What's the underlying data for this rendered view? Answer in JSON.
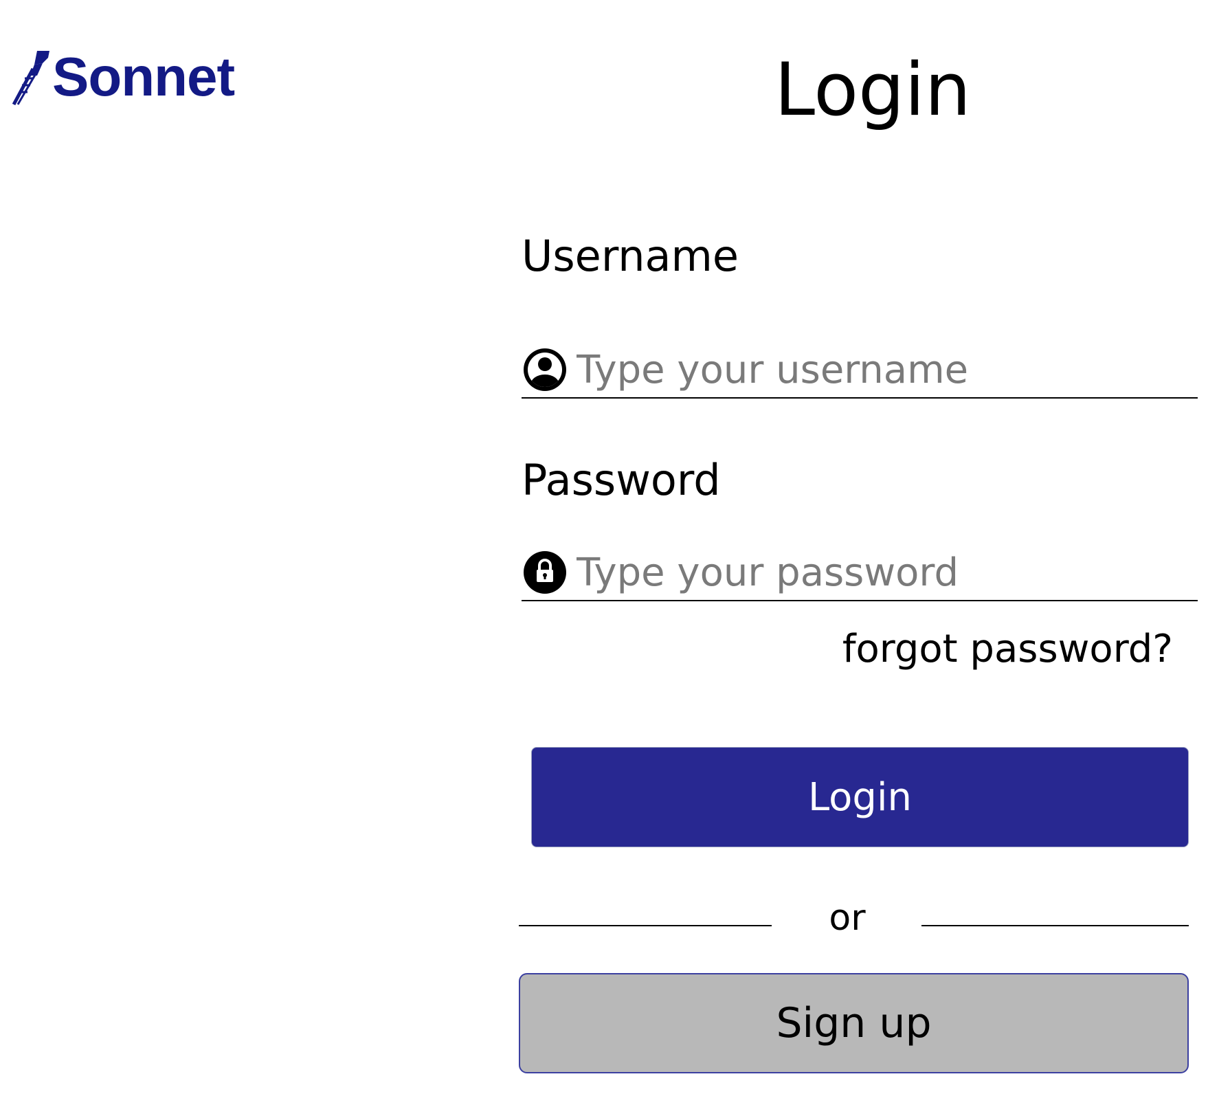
{
  "brand": {
    "name": "Sonnet",
    "logo_icon": "quill-pen-icon",
    "color": "#131a85"
  },
  "page": {
    "title": "Login"
  },
  "username": {
    "label": "Username",
    "placeholder": "Type your username",
    "value": "",
    "icon": "user-circle-icon"
  },
  "password": {
    "label": "Password",
    "placeholder": "Type your password",
    "value": "",
    "icon": "lock-circle-icon"
  },
  "forgot_password_label": "forgot password?",
  "login_button_label": "Login",
  "divider_text": "or",
  "signup_button_label": "Sign up",
  "colors": {
    "primary": "#282891",
    "secondary": "#b8b8b8",
    "placeholder": "#7a7a7a"
  }
}
